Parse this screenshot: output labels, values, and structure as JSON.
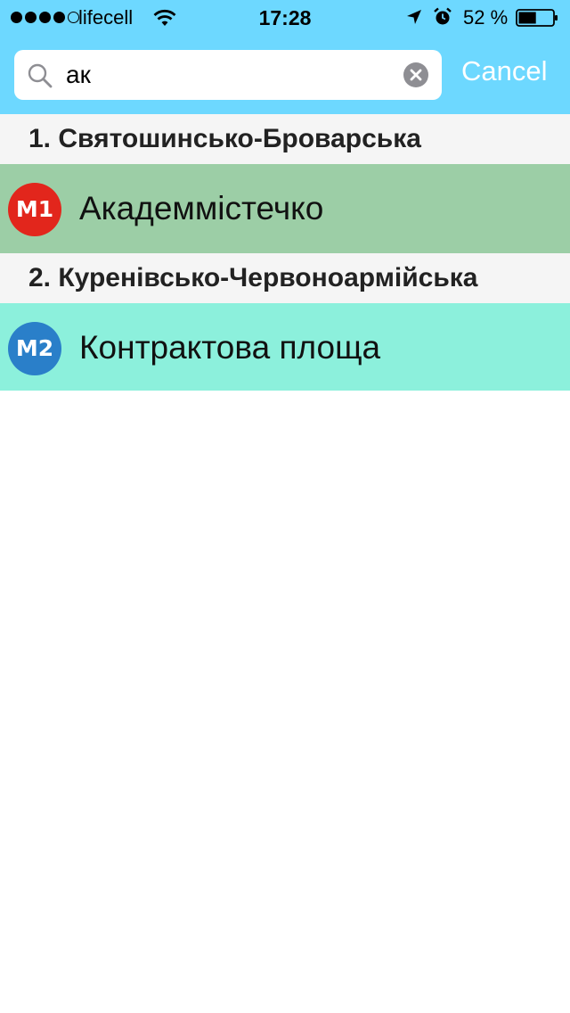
{
  "status_bar": {
    "carrier": "lifecell",
    "time": "17:28",
    "battery_percent": "52 %",
    "battery_level": 0.52,
    "signal_bars_filled": 4,
    "signal_bars_total": 5,
    "icons": [
      "wifi-icon",
      "location-arrow-icon",
      "alarm-icon",
      "battery-icon"
    ]
  },
  "search": {
    "query": "ак",
    "cancel_label": "Cancel"
  },
  "colors": {
    "header_blue": "#6dd8ff",
    "line1_row": "#9ccea6",
    "line1_badge": "#e2261c",
    "line2_row": "#8cf0dc",
    "line2_badge": "#2a7fc9",
    "section_bg": "#f5f5f5"
  },
  "sections": [
    {
      "title": "1. Святошинсько-Броварська",
      "stations": [
        {
          "badge": "M1",
          "name": "Академмістечко"
        }
      ]
    },
    {
      "title": "2. Куренівсько-Червоноармійська",
      "stations": [
        {
          "badge": "M2",
          "name": "Контрактова площа"
        }
      ]
    }
  ]
}
